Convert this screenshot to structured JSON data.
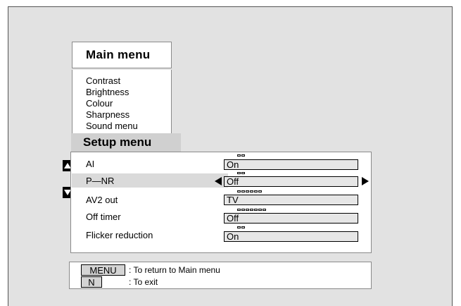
{
  "main_menu": {
    "title": "Main menu",
    "items": [
      "Contrast",
      "Brightness",
      "Colour",
      "Sharpness",
      "Sound menu"
    ]
  },
  "setup_menu": {
    "title": "Setup menu",
    "rows": [
      {
        "label": "AI",
        "value": "On"
      },
      {
        "label": "P—NR",
        "value": "Off"
      },
      {
        "label": "AV2 out",
        "value": "TV"
      },
      {
        "label": "Off timer",
        "value": "Off"
      },
      {
        "label": "Flicker reduction",
        "value": "On"
      }
    ]
  },
  "help": {
    "menu_key": "MENU",
    "menu_text": ": To return to Main menu",
    "n_key": "N",
    "n_text": ": To exit"
  },
  "icons": {
    "scroll_up": "up-triangle-icon",
    "scroll_down": "down-triangle-icon",
    "value_left": "left-arrow-icon",
    "value_right": "right-arrow-icon"
  }
}
